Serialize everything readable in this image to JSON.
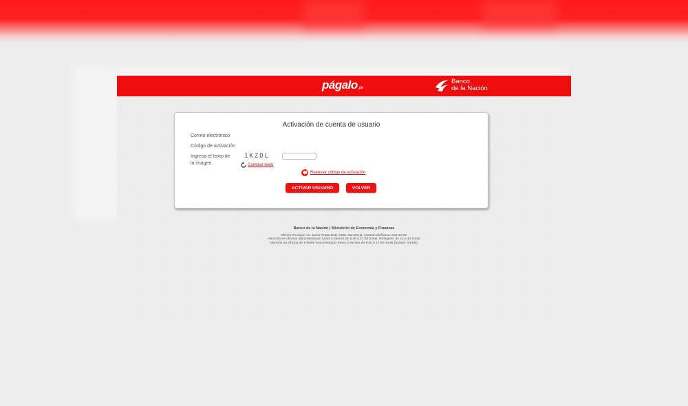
{
  "header": {
    "brand_pagalo": "págalo",
    "brand_pagalo_suffix": ".pe",
    "brand_bank_line1": "Banco",
    "brand_bank_line2": "de la Nación"
  },
  "form": {
    "title": "Activación de cuenta de usuario",
    "email_label": "Correo electrónico",
    "code_label": "Código de activación",
    "captcha_label": "Ingresa el texto de la imagen",
    "captcha_text": "1KZDL",
    "captcha_input_value": "",
    "refresh_link": "Cambiar texto",
    "resend_link": "Reenviar código de activación",
    "activate_button": "ACTIVAR USUARIO",
    "back_button": "VOLVER"
  },
  "footer": {
    "title": "Banco de la Nación | Ministerio de Economía y Finanzas",
    "lines": [
      "Oficina Principal: Av. Javier Prado Este 2499, San Borja. Central telefónica: 519-20 00.",
      "Atención en oficinas administrativas: lunes a viernes de 8:30 a 17:30 horas. Refrigerio: de 13 a 14 horas",
      "Atención en Oficina de Trámite Documentario: lunes a viernes de 9:00 a 17:00 horas (horario corrido)."
    ]
  },
  "colors": {
    "brand_red": "#ee0d0d",
    "link_red": "#cc1111"
  }
}
